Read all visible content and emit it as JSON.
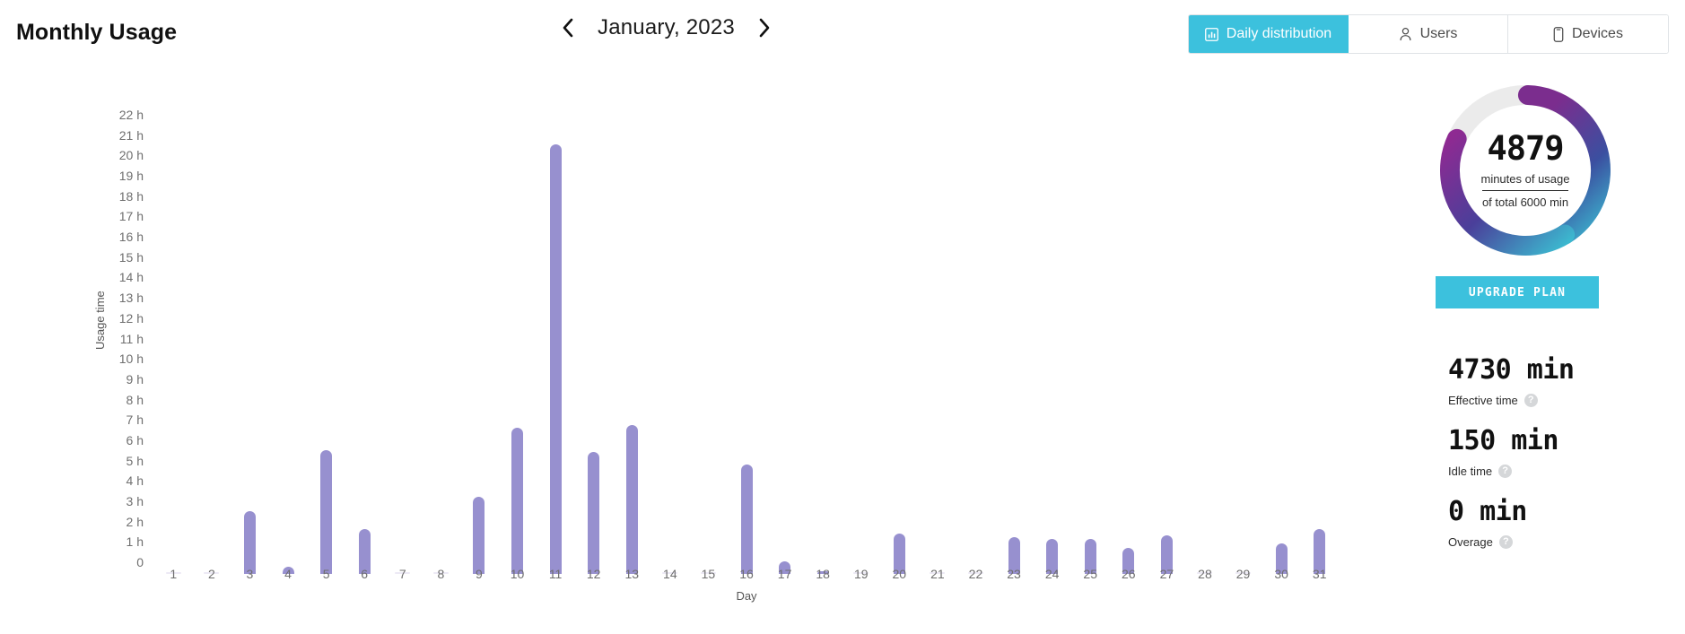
{
  "header": {
    "title": "Monthly Usage",
    "date_label": "January, 2023",
    "prev_icon": "chevron-left-icon",
    "next_icon": "chevron-right-icon",
    "tabs": [
      {
        "label": "Daily distribution",
        "icon": "bar-chart-icon",
        "active": true
      },
      {
        "label": "Users",
        "icon": "user-icon",
        "active": false
      },
      {
        "label": "Devices",
        "icon": "device-icon",
        "active": false
      }
    ]
  },
  "chart_data": {
    "type": "bar",
    "title": "Monthly Usage",
    "xlabel": "Day",
    "ylabel": "Usage time",
    "ylim": [
      0,
      22
    ],
    "grid": false,
    "legend": null,
    "ytick_labels": [
      "22 h",
      "21 h",
      "20 h",
      "19 h",
      "18 h",
      "17 h",
      "16 h",
      "15 h",
      "14 h",
      "13 h",
      "12 h",
      "11 h",
      "10 h",
      "9 h",
      "8 h",
      "7 h",
      "6 h",
      "5 h",
      "4 h",
      "3 h",
      "2 h",
      "1 h",
      "0"
    ],
    "ytick_values": [
      22,
      21,
      20,
      19,
      18,
      17,
      16,
      15,
      14,
      13,
      12,
      11,
      10,
      9,
      8,
      7,
      6,
      5,
      4,
      3,
      2,
      1,
      0
    ],
    "unit": "hours",
    "categories": [
      "1",
      "2",
      "3",
      "4",
      "5",
      "6",
      "7",
      "8",
      "9",
      "10",
      "11",
      "12",
      "13",
      "14",
      "15",
      "16",
      "17",
      "18",
      "19",
      "20",
      "21",
      "22",
      "23",
      "24",
      "25",
      "26",
      "27",
      "28",
      "29",
      "30",
      "31"
    ],
    "values": [
      0,
      0,
      3.1,
      0.35,
      6.1,
      2.2,
      0,
      0,
      3.8,
      7.2,
      21.1,
      6.0,
      7.3,
      0,
      0,
      5.4,
      0.6,
      0.1,
      0,
      2.0,
      0,
      0,
      1.8,
      1.7,
      1.7,
      1.3,
      1.9,
      0,
      0,
      1.5,
      2.2
    ]
  },
  "donut": {
    "value": "4879",
    "subtitle": "minutes of usage",
    "total_text": "of total 6000 min",
    "used_minutes": 4879,
    "total_minutes": 6000,
    "percent": 81.3,
    "track_color": "#ebebeb",
    "gradient_start": "#7b2d8e",
    "gradient_mid": "#3b4fa0",
    "gradient_end": "#3cb8cf"
  },
  "upgrade": {
    "label": "UPGRADE PLAN",
    "color": "#3cc1dd"
  },
  "stats": [
    {
      "value": "4730 min",
      "label": "Effective time",
      "help_icon": "help-circle-icon"
    },
    {
      "value": "150 min",
      "label": "Idle time",
      "help_icon": "help-circle-icon"
    },
    {
      "value": "0 min",
      "label": "Overage",
      "help_icon": "help-circle-icon"
    }
  ]
}
